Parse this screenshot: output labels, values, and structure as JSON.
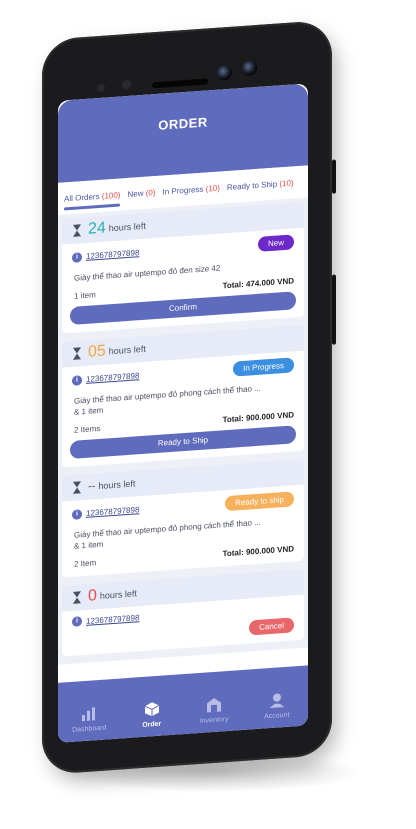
{
  "header": {
    "title": "ORDER"
  },
  "tabs": [
    {
      "label": "All Orders",
      "count": "(100)"
    },
    {
      "label": "New",
      "count": "(0)"
    },
    {
      "label": "In Progress",
      "count": "(10)"
    },
    {
      "label": "Ready to Ship",
      "count": "(10)"
    }
  ],
  "orders": [
    {
      "hours": "24",
      "hours_label": "hours left",
      "hours_color": "#29b3b3",
      "id": "123678797898",
      "status": "New",
      "description": "Giày thể thao air uptempo đỏ đen size 42",
      "qty": "1 item",
      "total": "Total: 474.000 VND",
      "action": "Confirm"
    },
    {
      "hours": "05",
      "hours_label": "hours left",
      "hours_color": "#f3a53f",
      "id": "123678797898",
      "status": "In Progress",
      "description": "Giày thể thao air uptempo đỏ phong cách thể thao ...",
      "description2": "& 1 item",
      "qty": "2 Items",
      "total": "Total: 900.000 VND",
      "action": "Ready to Ship"
    },
    {
      "hours": "--",
      "hours_label": "hours left",
      "id": "123678797898",
      "status": "Ready to ship",
      "description": "Giày thể thao air uptempo đỏ phong cách thể thao ...",
      "description2": "& 1 item",
      "qty": "2 Item",
      "total": "Total: 900.000 VND"
    },
    {
      "hours": "0",
      "hours_label": "hours left",
      "hours_color": "#e84d4d",
      "id": "123678797898",
      "status": "Cancel"
    }
  ],
  "nav": [
    {
      "label": "Dashboard",
      "icon": "bar-chart-icon"
    },
    {
      "label": "Order",
      "icon": "box-icon"
    },
    {
      "label": "Inventory",
      "icon": "warehouse-icon"
    },
    {
      "label": "Account",
      "icon": "user-icon"
    }
  ]
}
